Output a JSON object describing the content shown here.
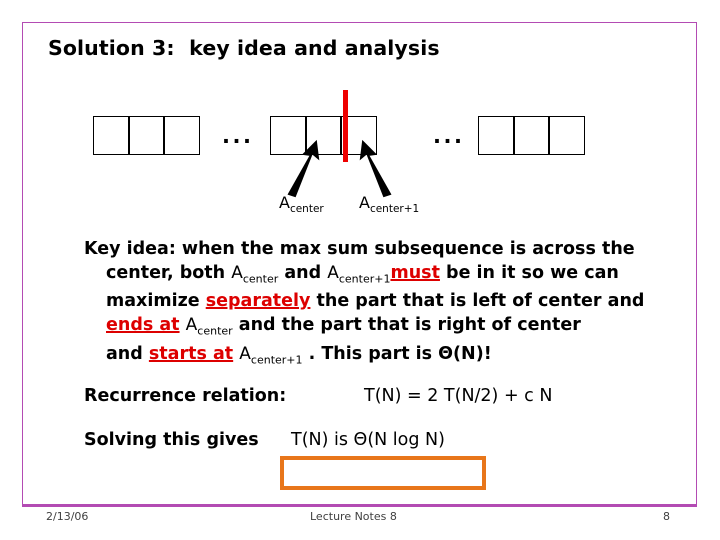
{
  "slide": {
    "title": "Solution 3:  key idea and analysis",
    "border_color": "#b34bb3",
    "background": "#ffffff"
  },
  "diagram": {
    "name": "array-split-diagram",
    "left_group_cells": 3,
    "middle_group_cells": 3,
    "right_group_cells": 3,
    "ellipsis_left": "...",
    "ellipsis_right": "...",
    "divider_color": "#ee0000",
    "labels": {
      "center": "A",
      "center_sub": "center",
      "center_plus_one": "A",
      "center_plus_one_sub": "center+1"
    }
  },
  "key_idea": {
    "lead": "Key idea:",
    "line1_rest": "  when the max sum subsequence is across the",
    "line2_a": "center, both ",
    "line2_var1": "A",
    "line2_var1_sub": "center",
    "line2_b": "  and ",
    "line2_var2": "A",
    "line2_var2_sub": "center+1",
    "line2_em": "must",
    "line2_c": " be in it so we can",
    "line3_a": "maximize ",
    "line3_em": "separately",
    "line3_b": " the part that is left of center and",
    "line4_em": "ends at",
    "line4_var": "A",
    "line4_var_sub": "center",
    "line4_b": "  and the part that is right of center",
    "line5_a": "and ",
    "line5_em": "starts at",
    "line5_var": "A",
    "line5_var_sub": "center+1",
    "line5_b": " . This part is Θ(N)!",
    "emphasis_color": "#dd0000"
  },
  "recurrence": {
    "label": "Recurrence relation:",
    "formula": "T(N)  = 2 T(N/2) + c N"
  },
  "solution": {
    "label": "Solving this gives",
    "formula": "T(N) is Θ(N log N)",
    "highlight_box_color": "#e8761a",
    "highlight_box_text": ""
  },
  "footer": {
    "date": "2/13/06",
    "center": "Lecture Notes 8",
    "page": "8"
  }
}
